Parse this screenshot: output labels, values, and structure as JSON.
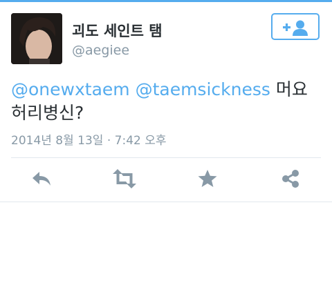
{
  "user": {
    "display_name": "괴도 세인트 탬",
    "handle": "@aegiee",
    "avatar_icon": "profile-photo"
  },
  "follow_button": {
    "icon": "add-user-icon",
    "label": "+"
  },
  "tweet": {
    "mention_1": "@onewxtaem",
    "mention_2": "@taemsickness",
    "text_part_1": " 머요",
    "text_part_2": "허리병신?",
    "timestamp": "2014년 8월 13일 · 7:42 오후"
  },
  "actions": [
    "reply-icon",
    "retweet-icon",
    "favorite-icon",
    "share-icon"
  ],
  "colors": {
    "accent": "#55acee",
    "text": "#292f33",
    "muted": "#8899a6",
    "icon": "#8899a6"
  }
}
